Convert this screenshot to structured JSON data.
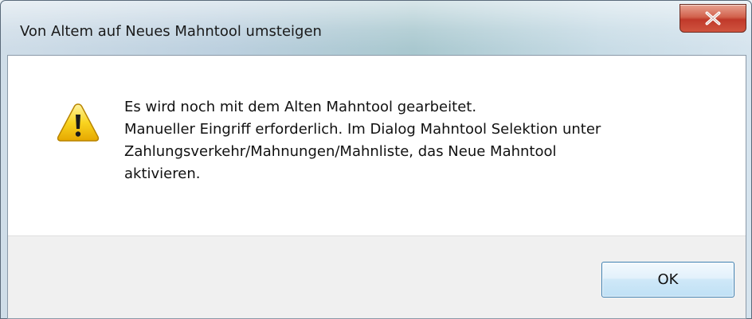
{
  "window": {
    "title": "Von Altem auf Neues Mahntool umsteigen",
    "close_icon": "close-x-icon"
  },
  "message": {
    "icon": "warning-icon",
    "lines": [
      "Es wird noch mit dem Alten Mahntool gearbeitet.",
      "Manueller Eingriff erforderlich. Im Dialog Mahntool Selektion unter",
      "Zahlungsverkehr/Mahnungen/Mahnliste, das Neue Mahntool",
      "aktivieren."
    ]
  },
  "buttons": {
    "ok_label": "OK"
  },
  "colors": {
    "close_button": "#c7442f",
    "ok_border": "#3c7fb1",
    "warning_yellow": "#f5c400"
  }
}
